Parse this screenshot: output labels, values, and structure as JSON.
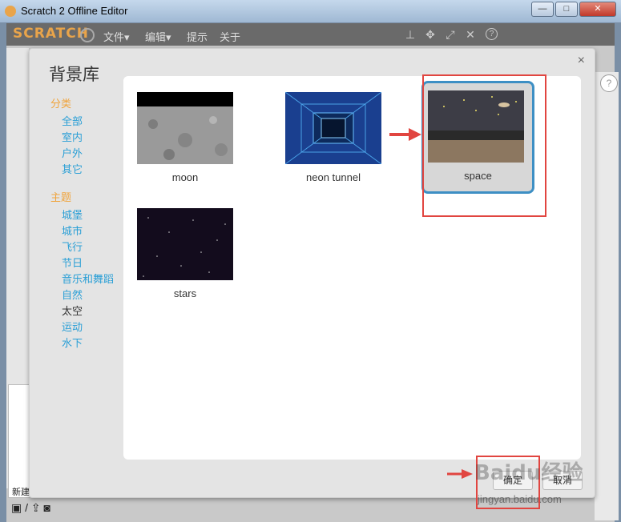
{
  "window": {
    "title": "Scratch 2 Offline Editor",
    "min": "—",
    "max": "□",
    "close": "✕"
  },
  "menubar": {
    "logo": "SCRATCH",
    "file": "文件▾",
    "edit": "编辑▾",
    "tips": "提示",
    "about": "关于",
    "tools": [
      "stamp-icon",
      "cut-icon",
      "grow-icon",
      "shrink-icon",
      "help-icon"
    ]
  },
  "dialog": {
    "title": "背景库",
    "close": "×",
    "categories": {
      "heading": "分类",
      "items": [
        "全部",
        "室内",
        "户外",
        "其它"
      ]
    },
    "themes": {
      "heading": "主题",
      "items": [
        "城堡",
        "城市",
        "飞行",
        "节日",
        "音乐和舞蹈",
        "自然",
        "太空",
        "运动",
        "水下"
      ],
      "active": "太空"
    },
    "backdrops": [
      {
        "label": "moon"
      },
      {
        "label": "neon tunnel"
      },
      {
        "label": "space"
      },
      {
        "label": "stars"
      }
    ],
    "ok_button": "确定",
    "cancel_button": "取消"
  },
  "editor": {
    "new_label": "新建"
  },
  "watermark": {
    "brand": "Baidu经验",
    "url": "jingyan.baidu.com"
  },
  "colors": {
    "accent_orange": "#f0a43c",
    "link_blue": "#2a9fd6",
    "selection_blue": "#3d8fc4",
    "annotation_red": "#e14540"
  }
}
